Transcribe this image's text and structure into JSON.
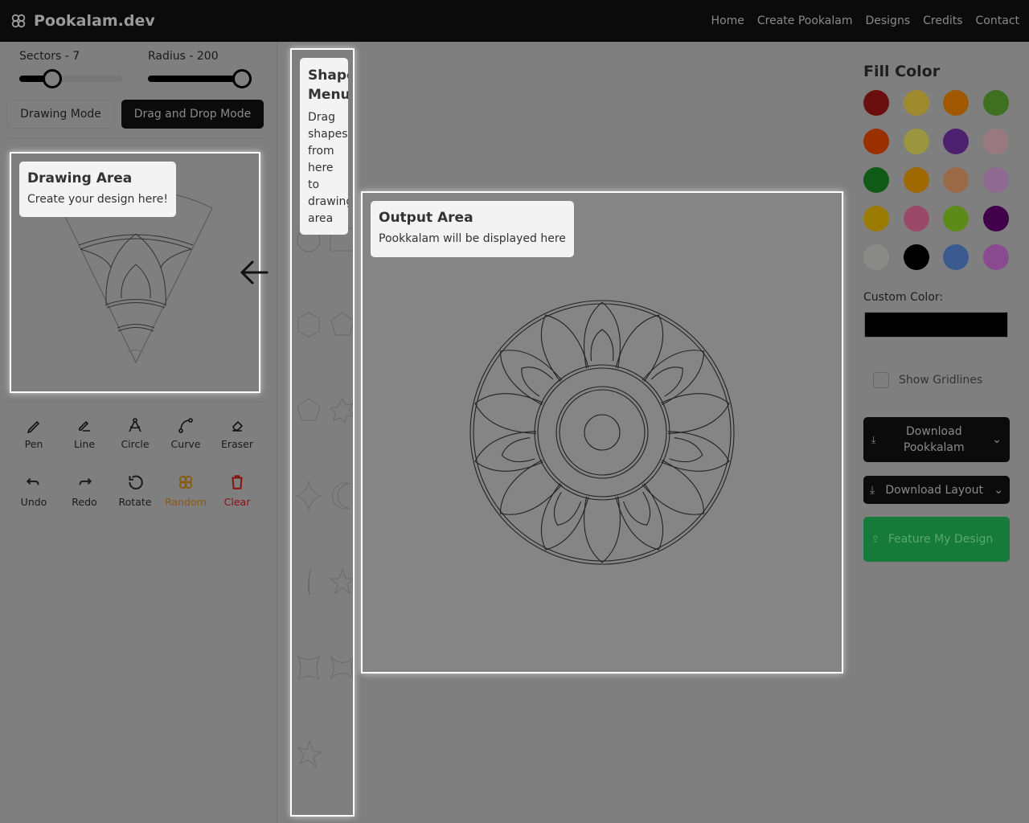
{
  "nav": {
    "brand": "Pookalam.dev",
    "links": [
      "Home",
      "Create Pookalam",
      "Designs",
      "Credits",
      "Contact"
    ]
  },
  "controls": {
    "sectors_label": "Sectors - 7",
    "sectors": 7,
    "radius_label": "Radius - 200",
    "radius": 200,
    "drawing_mode": "Drawing Mode",
    "drag_drop_mode": "Drag and Drop Mode",
    "active_mode": "Drag and Drop Mode"
  },
  "tour": {
    "drawing": {
      "title": "Drawing Area",
      "text": "Create your design here!"
    },
    "shape": {
      "title": "Shape Menu",
      "text": "Drag shapes from here to drawing area"
    },
    "output": {
      "title": "Output Area",
      "text": "Pookkalam will be displayed here"
    }
  },
  "tools": [
    {
      "label": "Pen",
      "icon": "pen-icon"
    },
    {
      "label": "Line",
      "icon": "line-icon"
    },
    {
      "label": "Circle",
      "icon": "compass-icon"
    },
    {
      "label": "Curve",
      "icon": "curve-icon"
    },
    {
      "label": "Eraser",
      "icon": "eraser-icon"
    }
  ],
  "actions": [
    {
      "label": "Undo",
      "icon": "undo-icon",
      "color": "#1a1a1a"
    },
    {
      "label": "Redo",
      "icon": "redo-icon",
      "color": "#1a1a1a"
    },
    {
      "label": "Rotate",
      "icon": "rotate-icon",
      "color": "#1a1a1a"
    },
    {
      "label": "Random",
      "icon": "flower-icon",
      "color": "#8a5a10"
    },
    {
      "label": "Clear",
      "icon": "trash-icon",
      "color": "#8a1010"
    }
  ],
  "fill": {
    "title": "Fill Color",
    "colors": [
      "#6b0e0e",
      "#a08a30",
      "#a05800",
      "#3f6f20",
      "#9a3000",
      "#9a9640",
      "#4e2070",
      "#9a7880",
      "#105a18",
      "#a06800",
      "#9a6a48",
      "#8e6a90",
      "#9a7a00",
      "#9a4868",
      "#5e8a1a",
      "#40004a",
      "#8a8a88",
      "#000000",
      "#3a5a90",
      "#8a4a90"
    ],
    "custom_label": "Custom Color:",
    "custom_value": "#000000"
  },
  "gridlines": {
    "label": "Show Gridlines",
    "checked": false
  },
  "buttons": {
    "download_pookkalam": "Download Pookkalam",
    "download_layout": "Download Layout",
    "feature": "Feature My Design"
  }
}
